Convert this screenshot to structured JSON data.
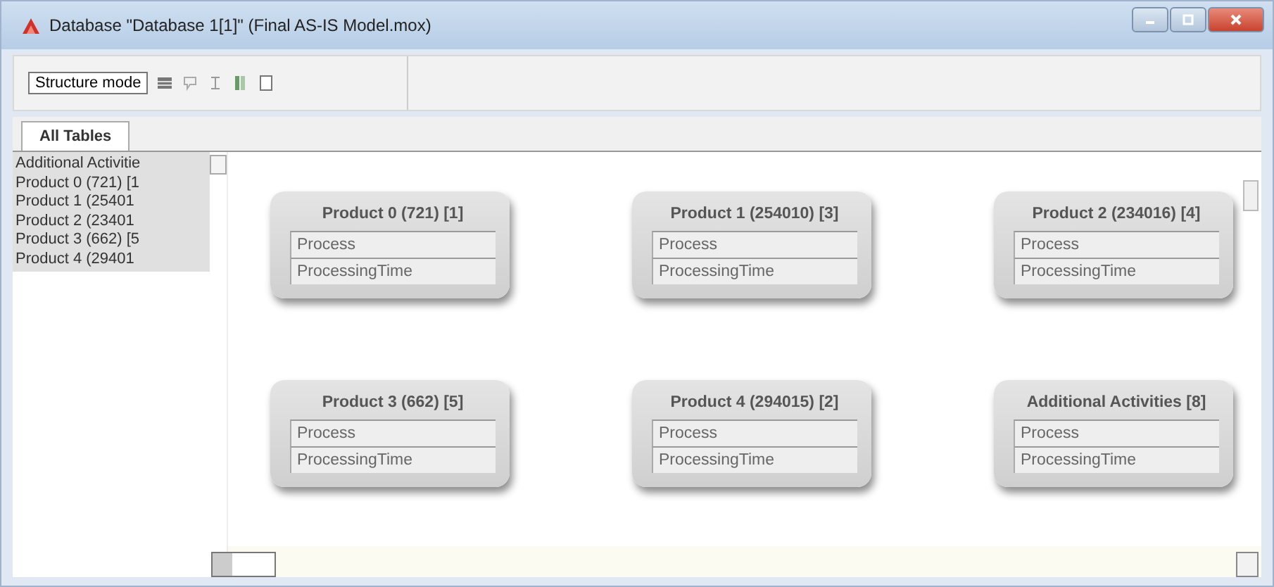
{
  "window": {
    "title": "Database \"Database 1[1]\" (Final AS-IS Model.mox)"
  },
  "toolbar": {
    "mode_dropdown": "Structure mode"
  },
  "tabs": [
    {
      "label": "All Tables",
      "selected": true
    }
  ],
  "table_list": [
    "Additional Activitie",
    "Product 0 (721) [1",
    "Product 1 (25401",
    "Product 2 (23401",
    "Product 3 (662) [5",
    "Product 4 (29401"
  ],
  "tables": [
    {
      "title": "Product 0 (721) [1]",
      "fields": [
        "Process",
        "ProcessingTime"
      ]
    },
    {
      "title": "Product 1 (254010) [3]",
      "fields": [
        "Process",
        "ProcessingTime"
      ]
    },
    {
      "title": "Product 2 (234016) [4]",
      "fields": [
        "Process",
        "ProcessingTime"
      ]
    },
    {
      "title": "Product 3 (662) [5]",
      "fields": [
        "Process",
        "ProcessingTime"
      ]
    },
    {
      "title": "Product 4 (294015) [2]",
      "fields": [
        "Process",
        "ProcessingTime"
      ]
    },
    {
      "title": "Additional Activities [8]",
      "fields": [
        "Process",
        "ProcessingTime"
      ]
    }
  ]
}
